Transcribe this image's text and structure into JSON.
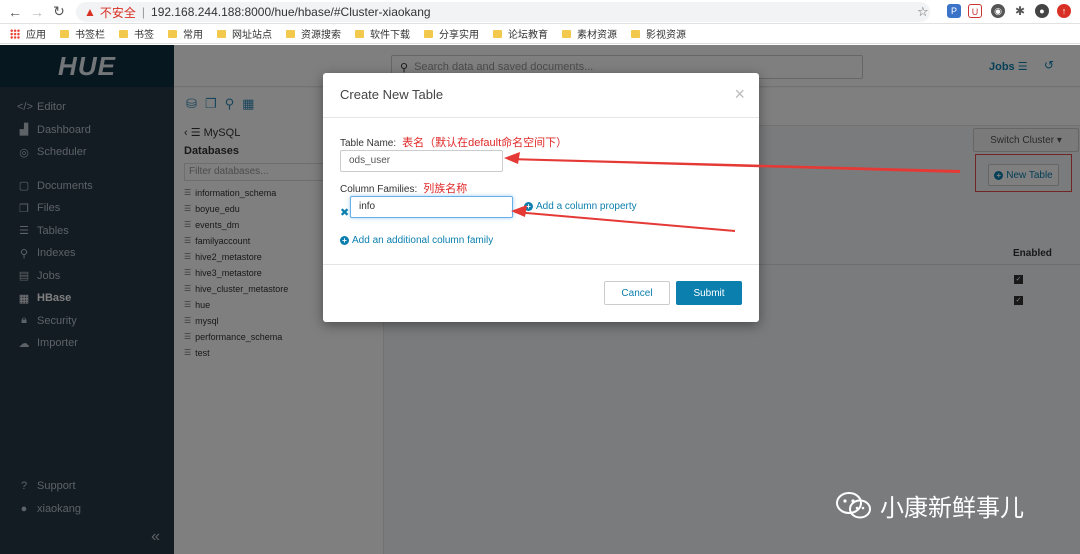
{
  "browser": {
    "insecure_label": "不安全",
    "url": "192.168.244.188:8000/hue/hbase/#Cluster-xiaokang",
    "bookmarks": [
      "应用",
      "书签栏",
      "书签",
      "常用",
      "网址站点",
      "资源搜索",
      "软件下载",
      "分享实用",
      "论坛教育",
      "素材资源",
      "影视资源"
    ]
  },
  "hue": {
    "logo": "HUE",
    "search_placeholder": "Search data and saved documents...",
    "jobs_label": "Jobs",
    "sidebar": {
      "items": [
        "Editor",
        "Dashboard",
        "Scheduler",
        "Documents",
        "Files",
        "Tables",
        "Indexes",
        "Jobs",
        "HBase",
        "Security",
        "Importer"
      ],
      "active": "HBase",
      "bottom": [
        "Support",
        "xiaokang"
      ]
    },
    "left_panel": {
      "back_label": "MySQL",
      "title": "Databases",
      "filter_placeholder": "Filter databases...",
      "databases": [
        "information_schema",
        "boyue_edu",
        "events_dm",
        "familyaccount",
        "hive2_metastore",
        "hive3_metastore",
        "hive_cluster_metastore",
        "hue",
        "mysql",
        "performance_schema",
        "test"
      ]
    },
    "main": {
      "switch_cluster": "Switch Cluster",
      "new_table": "New Table",
      "enabled_header": "Enabled"
    }
  },
  "modal": {
    "title": "Create New Table",
    "table_name_label": "Table Name:",
    "table_name_annotation": "表名（默认在default命名空间下）",
    "table_name_value": "ods_user",
    "column_families_label": "Column Families:",
    "column_families_annotation": "列族名称",
    "column_family_value": "info",
    "add_column_property": "Add a column property",
    "add_column_family": "Add an additional column family",
    "cancel": "Cancel",
    "submit": "Submit"
  },
  "watermark": "小康新鲜事儿",
  "colors": {
    "sidebar": "#263746",
    "accent": "#0b7fad",
    "annotation": "#e02727"
  }
}
